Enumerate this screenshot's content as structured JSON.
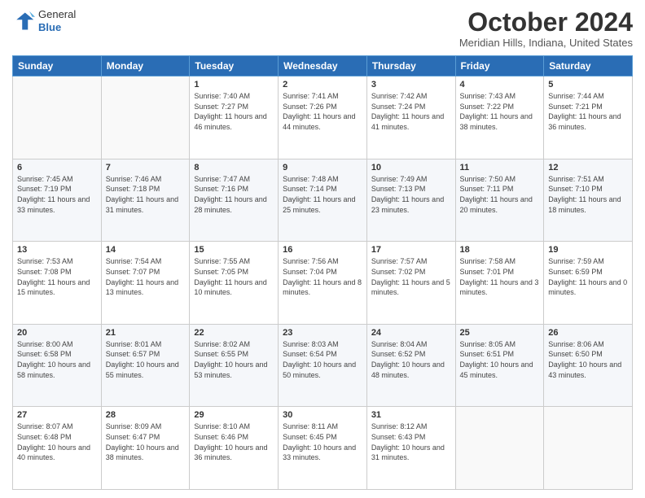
{
  "header": {
    "logo": {
      "general": "General",
      "blue": "Blue"
    },
    "title": "October 2024",
    "subtitle": "Meridian Hills, Indiana, United States"
  },
  "weekdays": [
    "Sunday",
    "Monday",
    "Tuesday",
    "Wednesday",
    "Thursday",
    "Friday",
    "Saturday"
  ],
  "weeks": [
    [
      {
        "day": "",
        "info": ""
      },
      {
        "day": "",
        "info": ""
      },
      {
        "day": "1",
        "info": "Sunrise: 7:40 AM\nSunset: 7:27 PM\nDaylight: 11 hours and 46 minutes."
      },
      {
        "day": "2",
        "info": "Sunrise: 7:41 AM\nSunset: 7:26 PM\nDaylight: 11 hours and 44 minutes."
      },
      {
        "day": "3",
        "info": "Sunrise: 7:42 AM\nSunset: 7:24 PM\nDaylight: 11 hours and 41 minutes."
      },
      {
        "day": "4",
        "info": "Sunrise: 7:43 AM\nSunset: 7:22 PM\nDaylight: 11 hours and 38 minutes."
      },
      {
        "day": "5",
        "info": "Sunrise: 7:44 AM\nSunset: 7:21 PM\nDaylight: 11 hours and 36 minutes."
      }
    ],
    [
      {
        "day": "6",
        "info": "Sunrise: 7:45 AM\nSunset: 7:19 PM\nDaylight: 11 hours and 33 minutes."
      },
      {
        "day": "7",
        "info": "Sunrise: 7:46 AM\nSunset: 7:18 PM\nDaylight: 11 hours and 31 minutes."
      },
      {
        "day": "8",
        "info": "Sunrise: 7:47 AM\nSunset: 7:16 PM\nDaylight: 11 hours and 28 minutes."
      },
      {
        "day": "9",
        "info": "Sunrise: 7:48 AM\nSunset: 7:14 PM\nDaylight: 11 hours and 25 minutes."
      },
      {
        "day": "10",
        "info": "Sunrise: 7:49 AM\nSunset: 7:13 PM\nDaylight: 11 hours and 23 minutes."
      },
      {
        "day": "11",
        "info": "Sunrise: 7:50 AM\nSunset: 7:11 PM\nDaylight: 11 hours and 20 minutes."
      },
      {
        "day": "12",
        "info": "Sunrise: 7:51 AM\nSunset: 7:10 PM\nDaylight: 11 hours and 18 minutes."
      }
    ],
    [
      {
        "day": "13",
        "info": "Sunrise: 7:53 AM\nSunset: 7:08 PM\nDaylight: 11 hours and 15 minutes."
      },
      {
        "day": "14",
        "info": "Sunrise: 7:54 AM\nSunset: 7:07 PM\nDaylight: 11 hours and 13 minutes."
      },
      {
        "day": "15",
        "info": "Sunrise: 7:55 AM\nSunset: 7:05 PM\nDaylight: 11 hours and 10 minutes."
      },
      {
        "day": "16",
        "info": "Sunrise: 7:56 AM\nSunset: 7:04 PM\nDaylight: 11 hours and 8 minutes."
      },
      {
        "day": "17",
        "info": "Sunrise: 7:57 AM\nSunset: 7:02 PM\nDaylight: 11 hours and 5 minutes."
      },
      {
        "day": "18",
        "info": "Sunrise: 7:58 AM\nSunset: 7:01 PM\nDaylight: 11 hours and 3 minutes."
      },
      {
        "day": "19",
        "info": "Sunrise: 7:59 AM\nSunset: 6:59 PM\nDaylight: 11 hours and 0 minutes."
      }
    ],
    [
      {
        "day": "20",
        "info": "Sunrise: 8:00 AM\nSunset: 6:58 PM\nDaylight: 10 hours and 58 minutes."
      },
      {
        "day": "21",
        "info": "Sunrise: 8:01 AM\nSunset: 6:57 PM\nDaylight: 10 hours and 55 minutes."
      },
      {
        "day": "22",
        "info": "Sunrise: 8:02 AM\nSunset: 6:55 PM\nDaylight: 10 hours and 53 minutes."
      },
      {
        "day": "23",
        "info": "Sunrise: 8:03 AM\nSunset: 6:54 PM\nDaylight: 10 hours and 50 minutes."
      },
      {
        "day": "24",
        "info": "Sunrise: 8:04 AM\nSunset: 6:52 PM\nDaylight: 10 hours and 48 minutes."
      },
      {
        "day": "25",
        "info": "Sunrise: 8:05 AM\nSunset: 6:51 PM\nDaylight: 10 hours and 45 minutes."
      },
      {
        "day": "26",
        "info": "Sunrise: 8:06 AM\nSunset: 6:50 PM\nDaylight: 10 hours and 43 minutes."
      }
    ],
    [
      {
        "day": "27",
        "info": "Sunrise: 8:07 AM\nSunset: 6:48 PM\nDaylight: 10 hours and 40 minutes."
      },
      {
        "day": "28",
        "info": "Sunrise: 8:09 AM\nSunset: 6:47 PM\nDaylight: 10 hours and 38 minutes."
      },
      {
        "day": "29",
        "info": "Sunrise: 8:10 AM\nSunset: 6:46 PM\nDaylight: 10 hours and 36 minutes."
      },
      {
        "day": "30",
        "info": "Sunrise: 8:11 AM\nSunset: 6:45 PM\nDaylight: 10 hours and 33 minutes."
      },
      {
        "day": "31",
        "info": "Sunrise: 8:12 AM\nSunset: 6:43 PM\nDaylight: 10 hours and 31 minutes."
      },
      {
        "day": "",
        "info": ""
      },
      {
        "day": "",
        "info": ""
      }
    ]
  ]
}
